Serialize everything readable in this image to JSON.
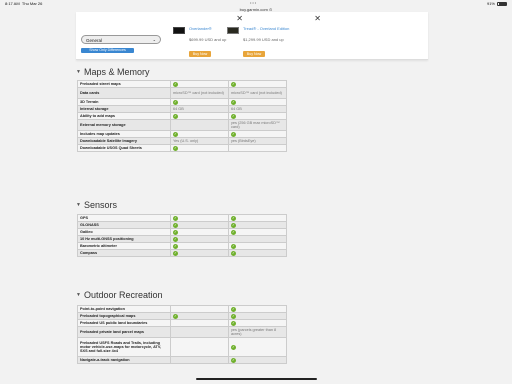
{
  "status": {
    "time": "8:17 AM",
    "date": "Thu Mar 26",
    "battery": "91%"
  },
  "browser": {
    "url": "buy.garmin.com"
  },
  "compare": {
    "select_value": "General",
    "diff_button": "Show Only Differences",
    "products": [
      {
        "name": "Overlander®",
        "price": "$699.99 USD and up",
        "buy": "Buy Now"
      },
      {
        "name": "Tread® - Overland Edition",
        "price": "$1,299.99 USD and up",
        "buy": "Buy Now"
      }
    ]
  },
  "sections": [
    {
      "title": "Maps & Memory",
      "rows": [
        {
          "label": "Preloaded street maps",
          "c1": "check",
          "c2": "check"
        },
        {
          "label": "Data cards",
          "c1": "microSD™ card (not included)",
          "c2": "microSD™ card (not included)"
        },
        {
          "label": "3D Terrain",
          "c1": "check",
          "c2": "check"
        },
        {
          "label": "Internal storage",
          "c1": "64 GB",
          "c2": "64 GB"
        },
        {
          "label": "Ability to add maps",
          "c1": "check",
          "c2": "check"
        },
        {
          "label": "External memory storage",
          "c1": "",
          "c2": "yes (256 GB max microSD™ card)"
        },
        {
          "label": "Includes map updates",
          "c1": "check",
          "c2": "check"
        },
        {
          "label": "Downloadable Satellite Imagery",
          "c1": "Yes (U.S. only)",
          "c2": "yes (BirdsEye)"
        },
        {
          "label": "Downloadable USGS Quad Sheets",
          "c1": "check",
          "c2": ""
        }
      ]
    },
    {
      "title": "Sensors",
      "rows": [
        {
          "label": "GPS",
          "c1": "check",
          "c2": "check"
        },
        {
          "label": "GLONASS",
          "c1": "check",
          "c2": "check"
        },
        {
          "label": "Galileo",
          "c1": "check",
          "c2": "check"
        },
        {
          "label": "10 Hz multi-GNSS positioning",
          "c1": "check",
          "c2": ""
        },
        {
          "label": "Barometric altimeter",
          "c1": "check",
          "c2": "check"
        },
        {
          "label": "Compass",
          "c1": "check",
          "c2": "check"
        }
      ]
    },
    {
      "title": "Outdoor Recreation",
      "rows": [
        {
          "label": "Point-to-point navigation",
          "c1": "",
          "c2": "check"
        },
        {
          "label": "Preloaded topographical maps",
          "c1": "check",
          "c2": "check"
        },
        {
          "label": "Preloaded US public land boundaries",
          "c1": "",
          "c2": "check"
        },
        {
          "label": "Preloaded private land parcel maps",
          "c1": "",
          "c2": "yes (parcels greater than 8 acres)"
        },
        {
          "label": "Preloaded USFS Roads and Trails, including motor vehicle-use-maps for motorcycle, ATV, SXS and full-size 4x4",
          "c1": "",
          "c2": "check"
        },
        {
          "label": "Navigate-a-track navigation",
          "c1": "",
          "c2": "check"
        }
      ]
    }
  ]
}
